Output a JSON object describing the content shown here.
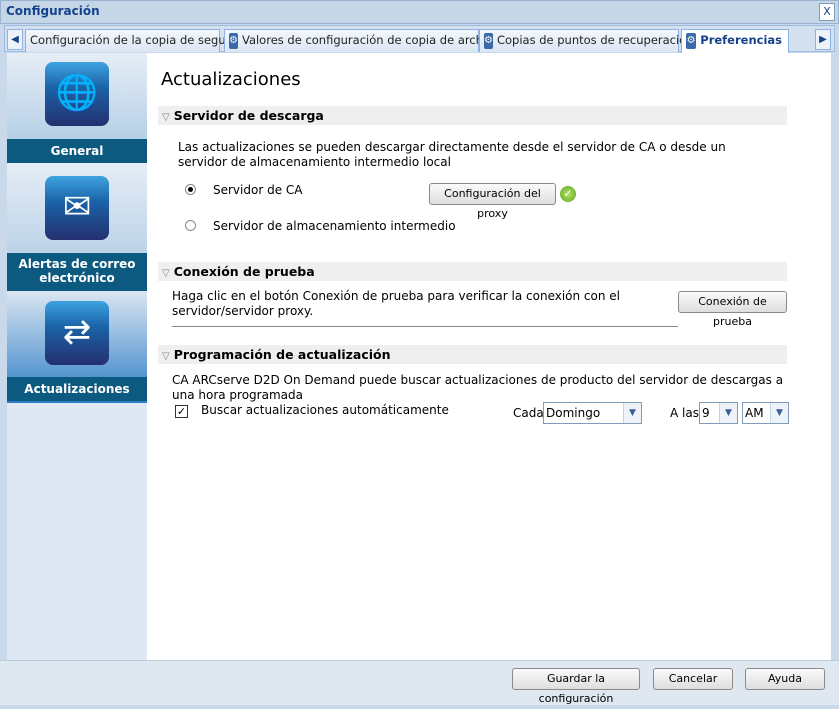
{
  "window": {
    "title": "Configuración",
    "close": "X"
  },
  "tabs": [
    {
      "label": "Configuración de la copia de seguridad",
      "active": false
    },
    {
      "label": "Valores de configuración de copia de archivo",
      "active": false
    },
    {
      "label": "Copias de puntos de recuperación",
      "active": false
    },
    {
      "label": "Preferencias",
      "active": true
    }
  ],
  "sidebar": {
    "items": [
      {
        "label": "General",
        "icon": "globe-icon"
      },
      {
        "label": "Alertas de correo electrónico",
        "icon": "mail-alert-icon"
      },
      {
        "label": "Actualizaciones",
        "icon": "arrows-exchange-icon",
        "selected": true
      }
    ]
  },
  "main": {
    "title": "Actualizaciones",
    "download": {
      "header": "Servidor de descarga",
      "description": "Las actualizaciones se pueden descargar directamente desde el servidor de CA o desde un servidor de almacenamiento intermedio local",
      "option_ca": "Servidor de CA",
      "option_staging": "Servidor de almacenamiento intermedio",
      "selected": "ca",
      "proxy_button": "Configuración del proxy"
    },
    "test": {
      "header": "Conexión de prueba",
      "description": "Haga clic en el botón Conexión de prueba para verificar la conexión con el servidor/servidor proxy.",
      "button": "Conexión de prueba"
    },
    "schedule": {
      "header": "Programación de actualización",
      "description": "CA ARCserve D2D On Demand puede buscar actualizaciones de producto del servidor de descargas a una hora programada",
      "auto_label": "Buscar actualizaciones automáticamente",
      "auto_checked": true,
      "every_label": "Cada",
      "day": "Domingo",
      "at_label": "A las",
      "hour": "9",
      "ampm": "AM"
    }
  },
  "footer": {
    "save": "Guardar la configuración",
    "cancel": "Cancelar",
    "help": "Ayuda"
  }
}
